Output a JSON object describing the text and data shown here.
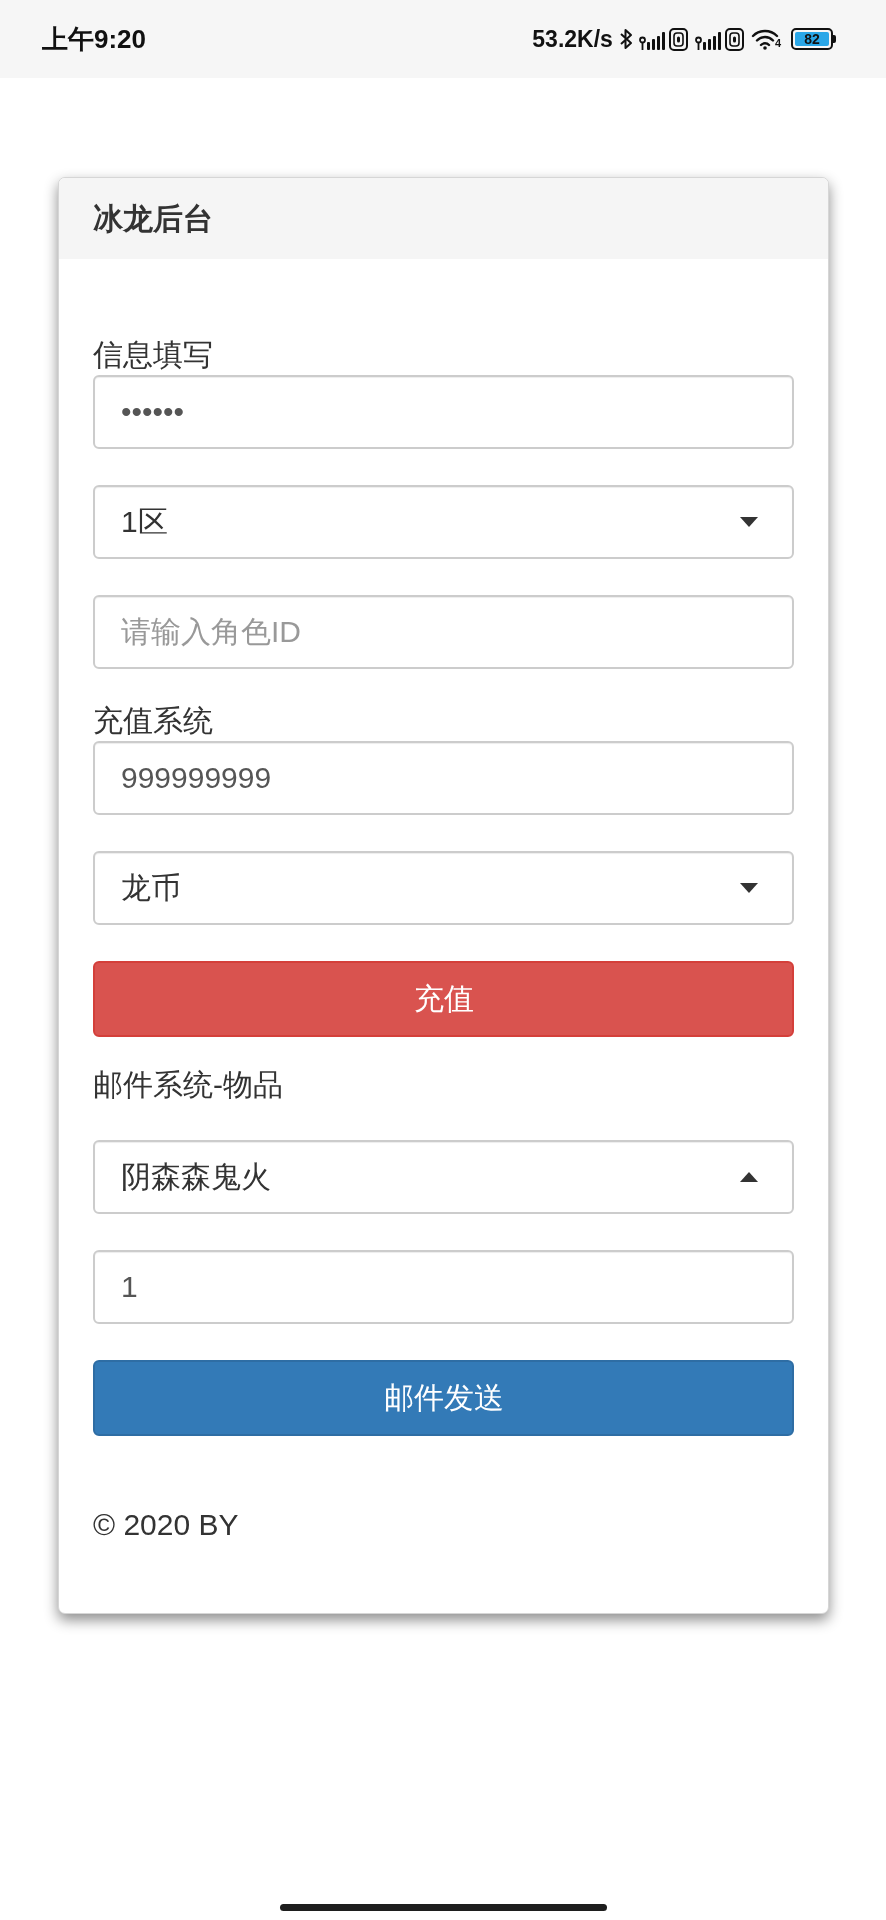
{
  "status_bar": {
    "time": "上午9:20",
    "network_speed": "53.2K/s",
    "wifi_badge": "4",
    "battery": "82"
  },
  "card": {
    "title": "冰龙后台",
    "items": [
      {
        "kind": "label",
        "text": "信息填写"
      },
      {
        "kind": "password",
        "value": "••••••"
      },
      {
        "kind": "select",
        "value": "1区",
        "expanded": false
      },
      {
        "kind": "input",
        "placeholder": "请输入角色ID"
      },
      {
        "kind": "label",
        "text": "充值系统"
      },
      {
        "kind": "input",
        "value": "999999999"
      },
      {
        "kind": "select",
        "value": "龙币",
        "expanded": false
      },
      {
        "kind": "button",
        "label": "充值"
      },
      {
        "kind": "heading",
        "text": "邮件系统-物品"
      },
      {
        "kind": "select",
        "value": "阴森森鬼火",
        "expanded": true
      },
      {
        "kind": "input",
        "value": "1"
      },
      {
        "kind": "button",
        "label": "邮件发送"
      }
    ],
    "footer": "© 2020 BY"
  }
}
